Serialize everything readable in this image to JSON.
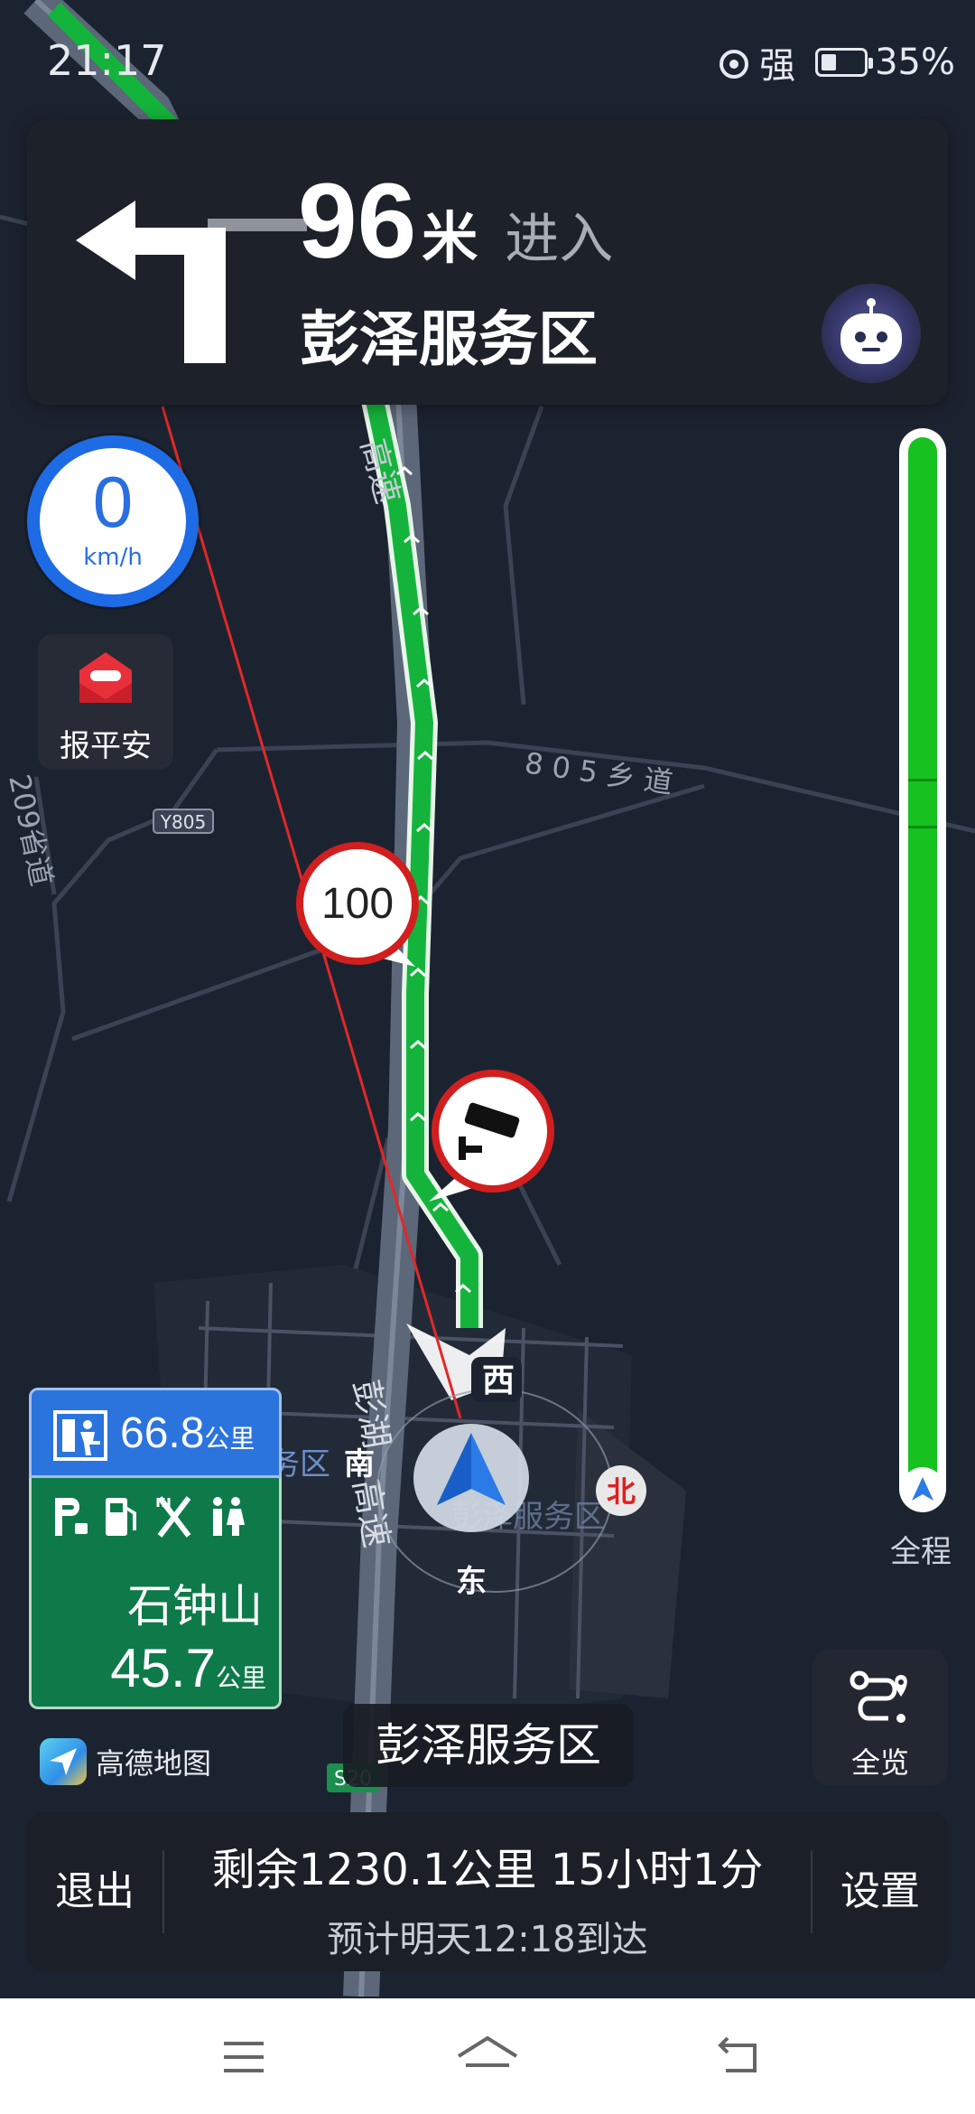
{
  "status_bar": {
    "time": "21:17",
    "signal_text": "强",
    "battery_text": "35%",
    "battery_level": 0.35
  },
  "nav": {
    "distance": "96",
    "distance_unit": "米",
    "action": "进入",
    "road": "彭泽服务区"
  },
  "speed": {
    "value": "0",
    "unit": "km/h"
  },
  "safety_button": {
    "label": "报平安"
  },
  "map_labels": {
    "expressway_top": "高速",
    "village_road": "805乡道",
    "provincial_road": "209省道",
    "road_code": "Y805",
    "speed_limit": "100",
    "compass_west": "西",
    "compass_south": "南",
    "compass_east": "东",
    "compass_north": "北",
    "expressway_bottom_1": "彭湖",
    "expressway_bottom_2": "高速",
    "service_area_faded": "彭泽服务区",
    "service_area_left": "务区",
    "road_code_bottom": "S20"
  },
  "progress": {
    "label": "全程",
    "completed_fraction": 0.0
  },
  "poi": {
    "next_distance": "66.8",
    "next_unit": "公里",
    "amenities": [
      "parking-icon",
      "fuel-icon",
      "dining-icon",
      "restroom-icon"
    ],
    "name": "石钟山",
    "distance": "45.7",
    "distance_unit": "公里"
  },
  "brand": {
    "name": "高德地图"
  },
  "current_road": "彭泽服务区",
  "overview": {
    "label": "全览"
  },
  "bottom": {
    "exit_label": "退出",
    "settings_label": "设置",
    "remaining": "剩余1230.1公里  15小时1分",
    "eta": "预计明天12:18到达"
  },
  "colors": {
    "route_green": "#14b43c",
    "accent_blue": "#2a6fe0",
    "poi_green": "#0e7a4a",
    "map_bg": "#1c2330"
  }
}
